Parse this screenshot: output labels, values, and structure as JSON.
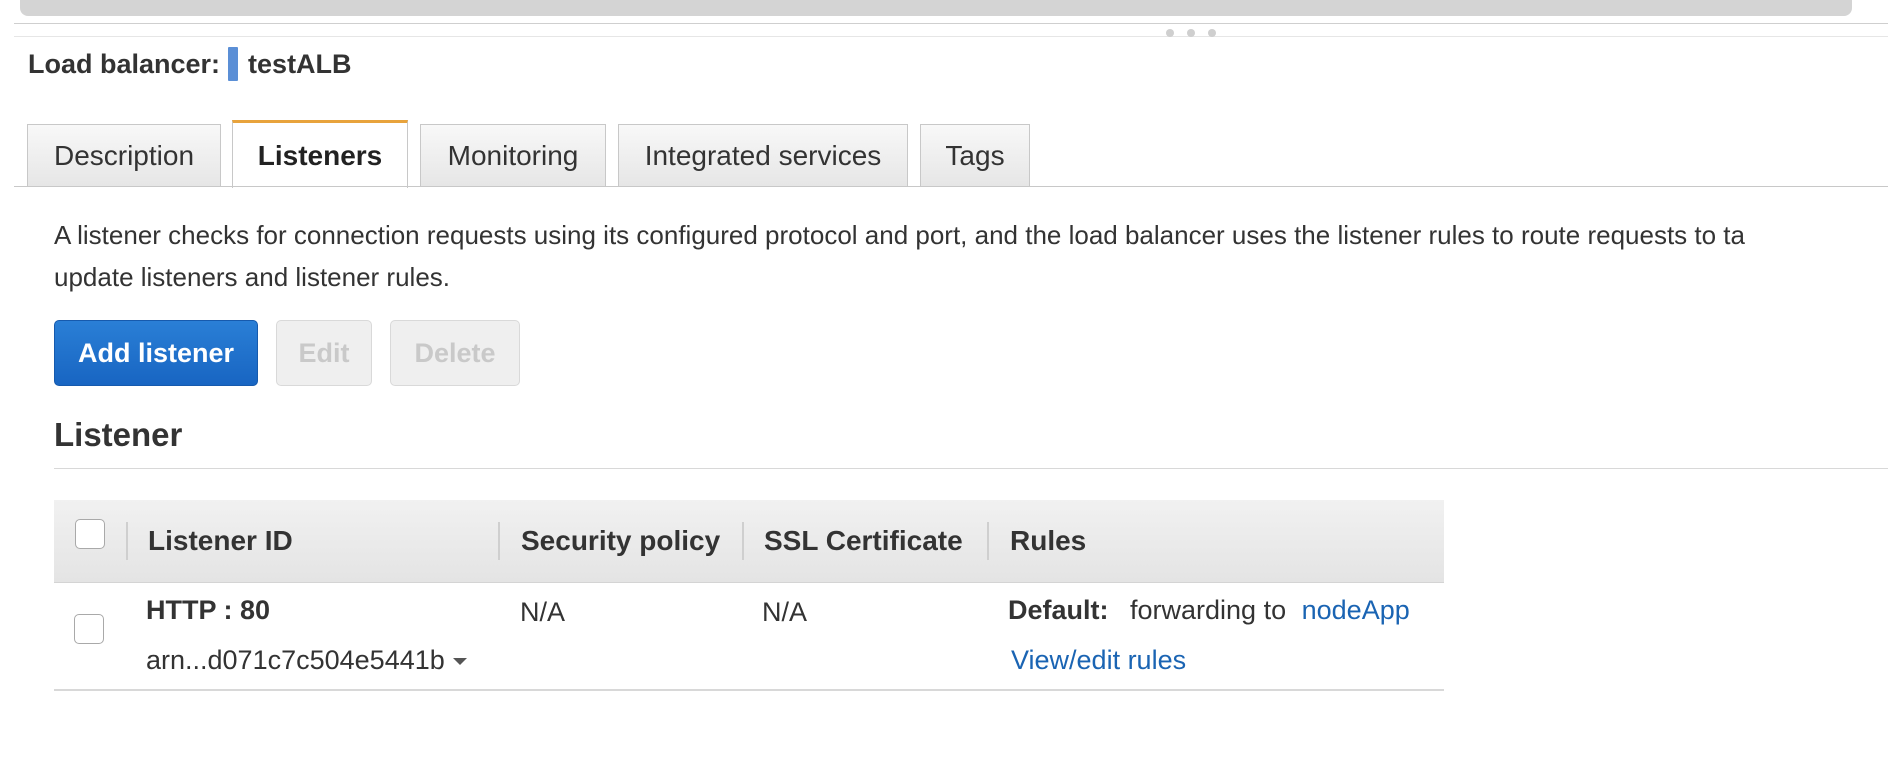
{
  "header": {
    "prefix": "Load balancer:",
    "name": "testALB",
    "color_marker": "#5b8fd6"
  },
  "tabs": [
    {
      "label": "Description",
      "active": false
    },
    {
      "label": "Listeners",
      "active": true
    },
    {
      "label": "Monitoring",
      "active": false
    },
    {
      "label": "Integrated services",
      "active": false
    },
    {
      "label": "Tags",
      "active": false
    }
  ],
  "description": {
    "line1": "A listener checks for connection requests using its configured protocol and port, and the load balancer uses the listener rules to route requests to ta",
    "line2": "update listeners and listener rules."
  },
  "actions": {
    "add_label": "Add listener",
    "edit_label": "Edit",
    "delete_label": "Delete",
    "edit_disabled": true,
    "delete_disabled": true
  },
  "section": {
    "title": "Listener"
  },
  "table": {
    "columns": [
      "Listener ID",
      "Security policy",
      "SSL Certificate",
      "Rules"
    ],
    "rows": [
      {
        "protocol_port": "HTTP : 80",
        "arn": "arn...d071c7c504e5441b",
        "security_policy": "N/A",
        "ssl_certificate": "N/A",
        "rules_default_label": "Default:",
        "rules_forward_text": "forwarding to",
        "rules_target": "nodeApp",
        "rules_link": "View/edit rules"
      }
    ]
  },
  "colors": {
    "accent_tab": "#e8a33c",
    "primary_button": "#1865c2",
    "link": "#1a64b3"
  },
  "icons": {
    "arn_dropdown": "caret-down-icon"
  }
}
